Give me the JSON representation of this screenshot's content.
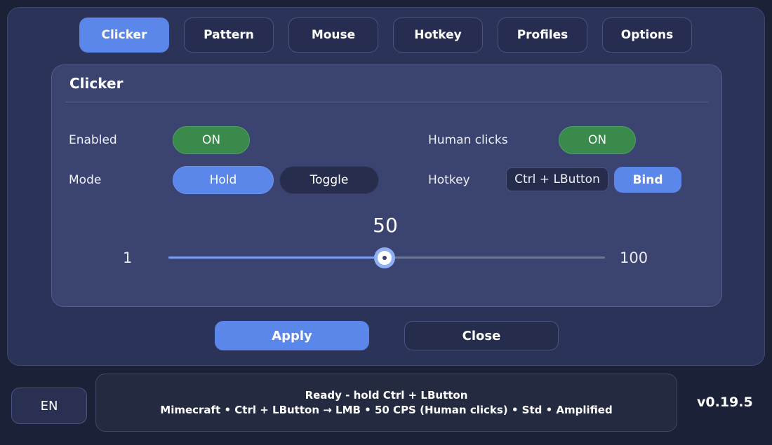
{
  "tabs": [
    {
      "label": "Clicker",
      "active": true
    },
    {
      "label": "Pattern",
      "active": false
    },
    {
      "label": "Mouse",
      "active": false
    },
    {
      "label": "Hotkey",
      "active": false
    },
    {
      "label": "Profiles",
      "active": false
    },
    {
      "label": "Options",
      "active": false
    }
  ],
  "panel": {
    "title": "Clicker",
    "enabled": {
      "label": "Enabled",
      "value": "ON"
    },
    "human_clicks": {
      "label": "Human clicks",
      "value": "ON"
    },
    "mode": {
      "label": "Mode",
      "options": [
        "Hold",
        "Toggle"
      ],
      "selected": "Hold"
    },
    "hotkey": {
      "label": "Hotkey",
      "value": "Ctrl + LButton",
      "bind_label": "Bind"
    },
    "cps_slider": {
      "value": "50",
      "min": "1",
      "max": "100",
      "fraction": 0.4949
    }
  },
  "actions": {
    "apply_label": "Apply",
    "close_label": "Close"
  },
  "footer": {
    "language": "EN",
    "status_line1": "Ready - hold Ctrl + LButton",
    "status_line2": "Mimecraft  •  Ctrl + LButton → LMB  •  50 CPS (Human clicks)  •  Std  •  Amplified",
    "version": "v0.19.5"
  },
  "colors": {
    "accent": "#5b86ea",
    "on_green": "#3a8a4c",
    "window_bg": "#2b3358",
    "panel_bg": "#3b4470",
    "page_bg": "#1b2238"
  }
}
